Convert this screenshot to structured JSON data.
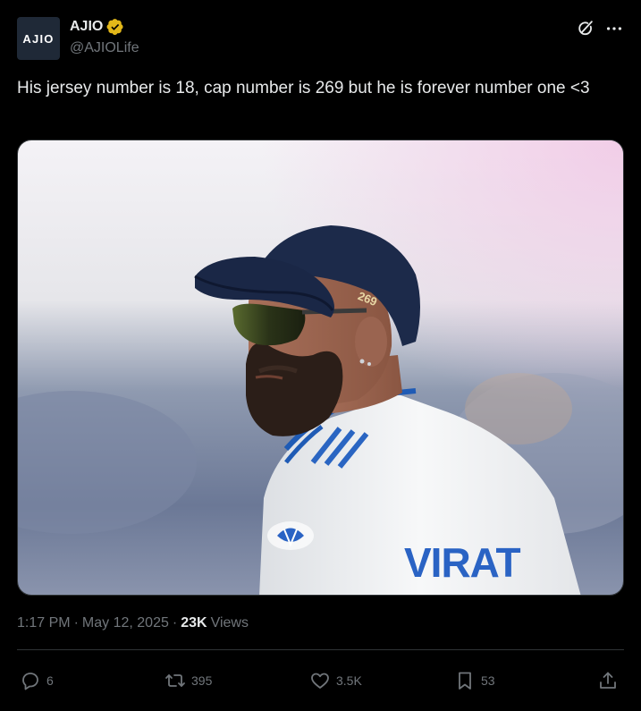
{
  "account": {
    "display_name": "AJIO",
    "handle": "@AJIOLife",
    "avatar_text": "AJIO",
    "verified_badge_color": "#e2b719"
  },
  "tweet": {
    "text": "His jersey number is 18, cap number is 269 but he is forever number one <3",
    "image": {
      "cap_text": "269",
      "jersey_text": "VIRAT"
    }
  },
  "meta": {
    "time": "1:17 PM",
    "date": "May 12, 2025",
    "separator": "·",
    "views_count": "23K",
    "views_label": "Views"
  },
  "actions": {
    "replies": "6",
    "reposts": "395",
    "likes": "3.5K",
    "bookmarks": "53"
  },
  "icons": [
    "verified-badge-icon",
    "grok-icon",
    "more-icon",
    "reply-icon",
    "repost-icon",
    "like-icon",
    "bookmark-icon",
    "share-icon"
  ],
  "colors": {
    "background": "#000000",
    "text_primary": "#e7e9ea",
    "text_secondary": "#71767b",
    "border": "#2f3336"
  }
}
